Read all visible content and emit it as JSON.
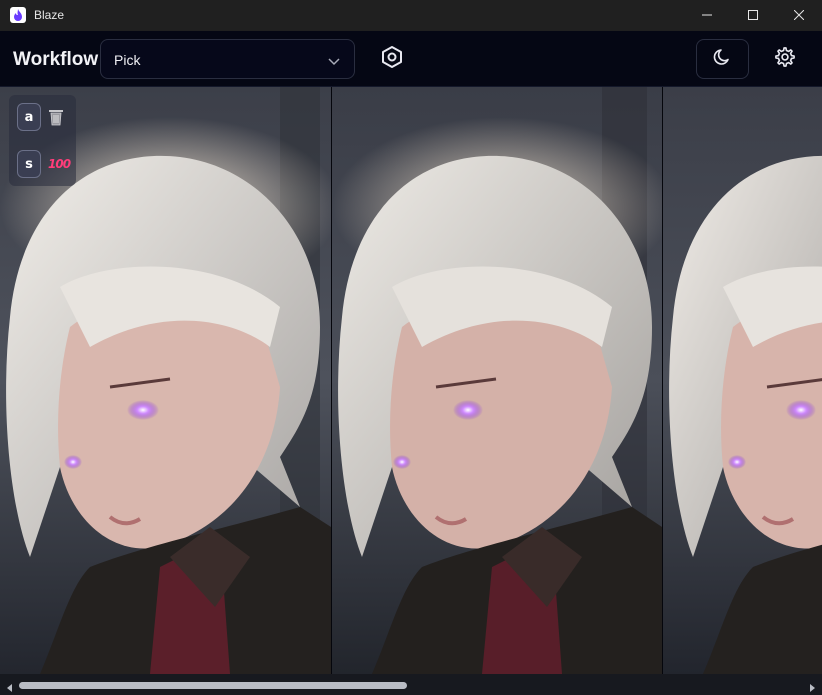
{
  "window": {
    "title": "Blaze",
    "minimize_icon": "minimize-icon",
    "maximize_icon": "maximize-icon",
    "close_icon": "close-icon"
  },
  "toolbar": {
    "workflow_label": "Workflow",
    "workflow_select": {
      "value": "Pick"
    },
    "icons": [
      "hexagon-icon",
      "moon-icon",
      "gear-icon"
    ]
  },
  "hotkeys": [
    {
      "key": "a",
      "icon": "trash-icon"
    },
    {
      "key": "s",
      "icon": "score-icon",
      "icon_text": "100"
    }
  ],
  "gallery": {
    "images": [
      {
        "subject": "white-haired anime girl with purple eyes"
      },
      {
        "subject": "white-haired anime girl with purple eyes"
      },
      {
        "subject": "white-haired anime girl with purple eyes"
      }
    ]
  },
  "colors": {
    "titlebar": "#202020",
    "toolbar": "#050714",
    "accent_score": "#ff3d7a",
    "eye_glow": "#b45cff"
  }
}
